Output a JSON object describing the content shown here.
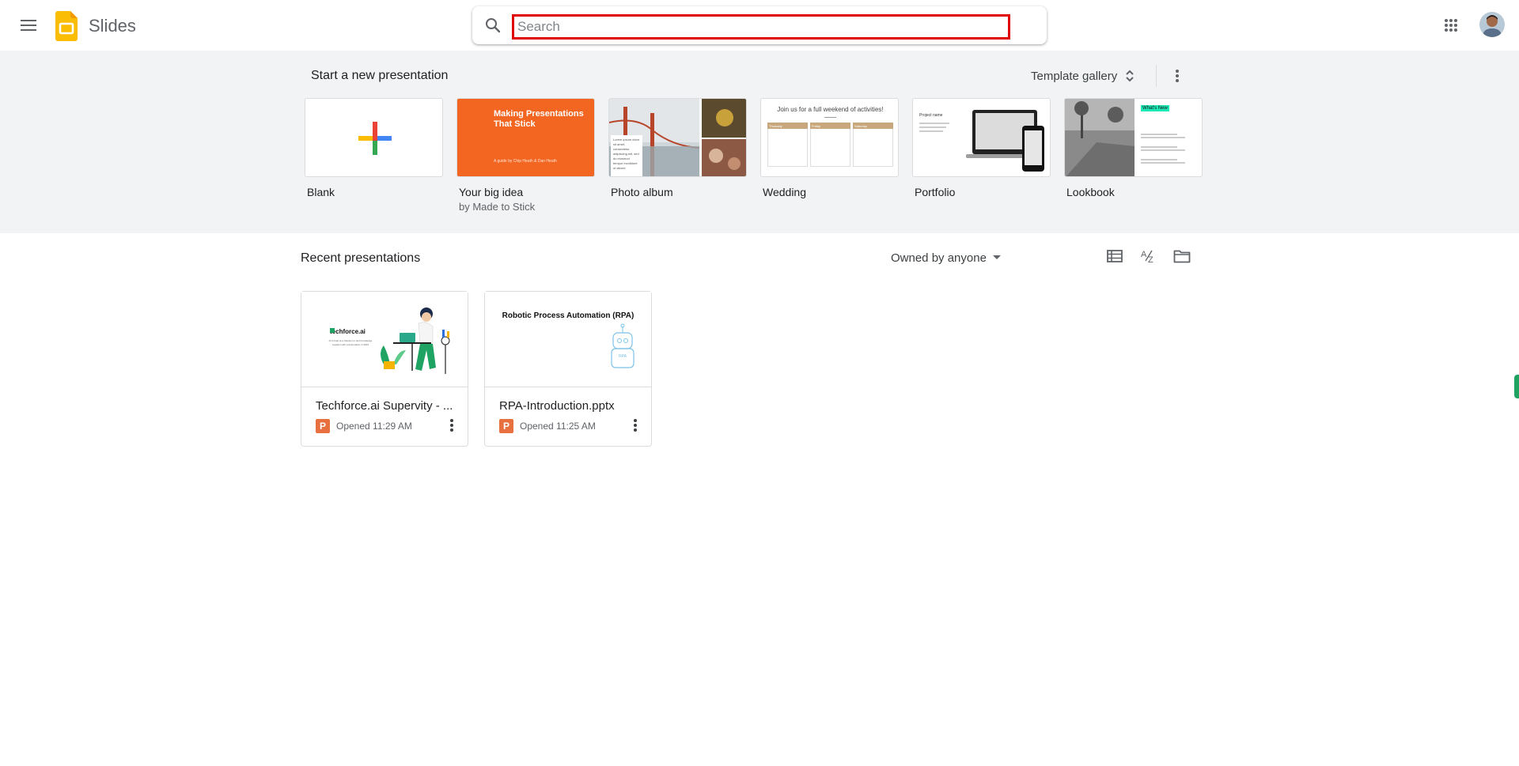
{
  "app": {
    "name": "Slides"
  },
  "search": {
    "placeholder": "Search",
    "value": ""
  },
  "templates": {
    "section_title": "Start a new presentation",
    "gallery_label": "Template gallery",
    "items": [
      {
        "label": "Blank",
        "sub": ""
      },
      {
        "label": "Your big idea",
        "sub": "by Made to Stick",
        "thumb_title": "Making Presentations That Stick",
        "thumb_byline": "A guide by Chip Heath & Dan Heath"
      },
      {
        "label": "Photo album",
        "sub": "",
        "thumb_caption": "Lorem ipsum dolor sit amet, consectetur adipiscing elit, sed do eiusmod tempor incididunt ut labore"
      },
      {
        "label": "Wedding",
        "sub": "",
        "thumb_title": "Join us for a full weekend of activities!",
        "thumb_cols": [
          "Thursday",
          "Friday",
          "Saturday"
        ]
      },
      {
        "label": "Portfolio",
        "sub": "",
        "thumb_title": "Project name"
      },
      {
        "label": "Lookbook",
        "sub": "",
        "thumb_title": "What's New"
      }
    ]
  },
  "recent": {
    "section_title": "Recent presentations",
    "owner_filter": "Owned by anyone",
    "documents": [
      {
        "title": "Techforce.ai Supervity - ...",
        "opened": "Opened 11:29 AM",
        "thumb_brand": "techforce.ai",
        "thumb_text": "AI is Fast at a Solution to Get Knowledge Leaders with a Automation in 2023"
      },
      {
        "title": "RPA-Introduction.pptx",
        "opened": "Opened 11:25 AM",
        "thumb_title": "Robotic Process Automation (RPA)",
        "thumb_badge": "RPA"
      }
    ]
  },
  "colors": {
    "accent": "#1a73e8",
    "slides_yellow": "#fbbc04",
    "ppt_orange": "#e8703f",
    "focus_border": "#e00000"
  }
}
